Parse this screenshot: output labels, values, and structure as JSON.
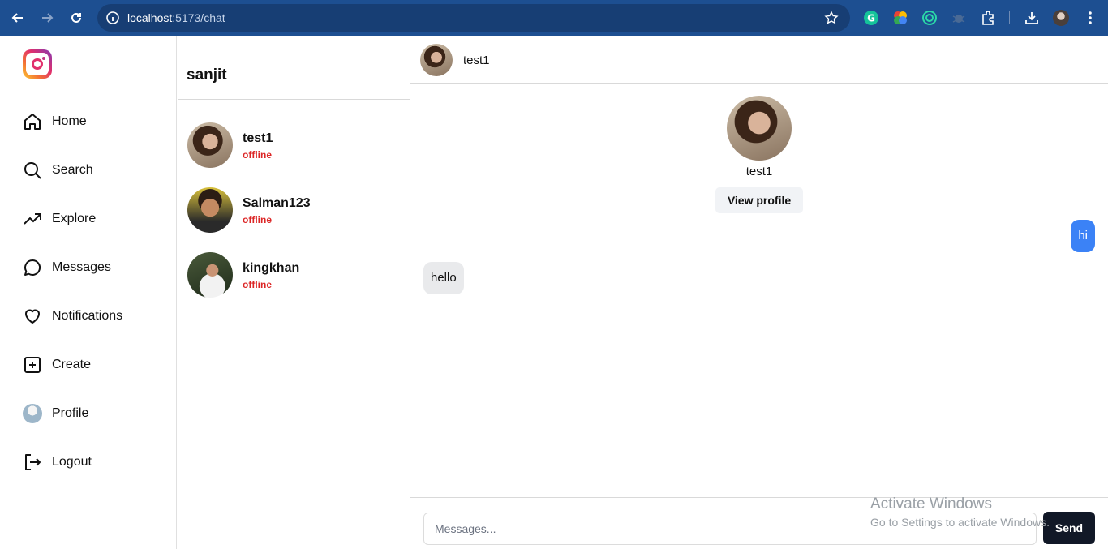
{
  "browser": {
    "url_host": "localhost",
    "url_path": ":5173/chat"
  },
  "sidebar": {
    "items": [
      {
        "label": "Home",
        "icon": "home-icon"
      },
      {
        "label": "Search",
        "icon": "search-icon"
      },
      {
        "label": "Explore",
        "icon": "trending-icon"
      },
      {
        "label": "Messages",
        "icon": "message-icon"
      },
      {
        "label": "Notifications",
        "icon": "heart-icon"
      },
      {
        "label": "Create",
        "icon": "plus-square-icon"
      },
      {
        "label": "Profile",
        "icon": "avatar"
      },
      {
        "label": "Logout",
        "icon": "logout-icon"
      }
    ]
  },
  "conversations": {
    "current_user": "sanjit",
    "items": [
      {
        "name": "test1",
        "status": "offline"
      },
      {
        "name": "Salman123",
        "status": "offline"
      },
      {
        "name": "kingkhan",
        "status": "offline"
      }
    ]
  },
  "chat": {
    "header_name": "test1",
    "profile_name": "test1",
    "view_profile_label": "View profile",
    "messages": [
      {
        "text": "hi",
        "direction": "outgoing"
      },
      {
        "text": "hello",
        "direction": "incoming"
      }
    ],
    "input_placeholder": "Messages...",
    "send_label": "Send"
  },
  "overlay": {
    "activate_title": "Activate Windows",
    "activate_subtitle": "Go to Settings to activate Windows."
  },
  "colors": {
    "browser_bar": "#1d4f91",
    "outgoing_bubble": "#3b82f6",
    "status_offline": "#dc2626",
    "send_button": "#111827"
  }
}
